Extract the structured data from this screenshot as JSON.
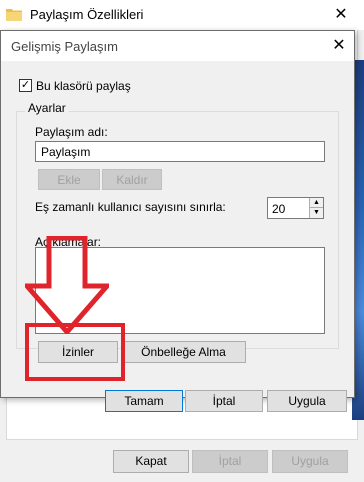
{
  "back_window": {
    "title": "Paylaşım Özellikleri",
    "close_glyph": "✕",
    "buttons": {
      "close_label": "Kapat",
      "cancel_label": "İptal",
      "apply_label": "Uygula"
    }
  },
  "dialog": {
    "title": "Gelişmiş Paylaşım",
    "close_glyph": "✕",
    "share_checkbox": {
      "label": "Bu klasörü paylaş",
      "checked": true,
      "mark": "✓"
    },
    "settings_group": {
      "legend": "Ayarlar",
      "share_name_label": "Paylaşım adı:",
      "share_name_value": "Paylaşım",
      "add_label": "Ekle",
      "remove_label": "Kaldır",
      "limit_label": "Eş zamanlı kullanıcı sayısını sınırla:",
      "limit_value": "20",
      "comments_label": "Açıklamalar:",
      "permissions_label": "İzinler",
      "caching_label": "Önbelleğe Alma"
    },
    "buttons": {
      "ok_label": "Tamam",
      "cancel_label": "İptal",
      "apply_label": "Uygula"
    }
  },
  "annotation": {
    "color": "#e0242c",
    "icons": [
      "down-arrow-icon",
      "highlight-box"
    ]
  }
}
